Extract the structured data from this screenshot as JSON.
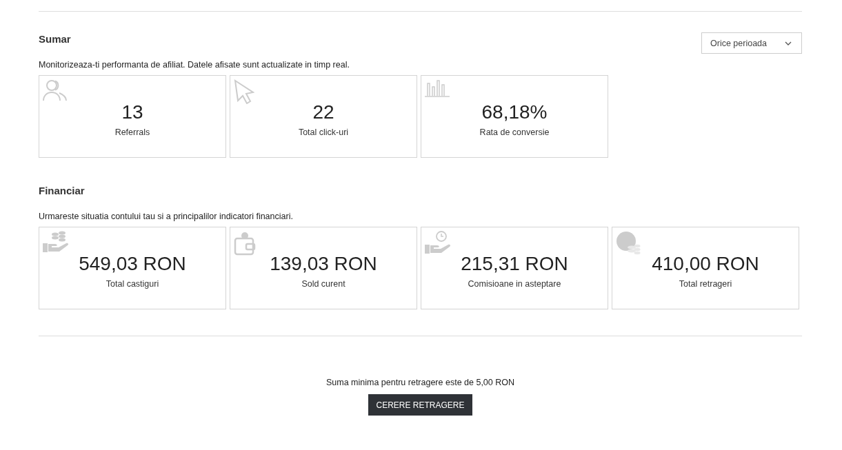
{
  "summary": {
    "title": "Sumar",
    "period_select": {
      "value": "Orice perioada"
    },
    "description": "Monitorizeaza-ti performanta de afiliat. Datele afisate sunt actualizate in timp real.",
    "cards": [
      {
        "value": "13",
        "label": "Referrals"
      },
      {
        "value": "22",
        "label": "Total click-uri"
      },
      {
        "value": "68,18%",
        "label": "Rata de conversie"
      }
    ]
  },
  "financial": {
    "title": "Financiar",
    "description": "Urmareste situatia contului tau si a principalilor indicatori financiari.",
    "cards": [
      {
        "value": "549,03 RON",
        "label": "Total castiguri"
      },
      {
        "value": "139,03 RON",
        "label": "Sold curent"
      },
      {
        "value": "215,31 RON",
        "label": "Comisioane in asteptare"
      },
      {
        "value": "410,00 RON",
        "label": "Total retrageri"
      }
    ]
  },
  "withdrawal": {
    "note": "Suma minima pentru retragere este de 5,00 RON",
    "button": "CERERE RETRAGERE"
  }
}
